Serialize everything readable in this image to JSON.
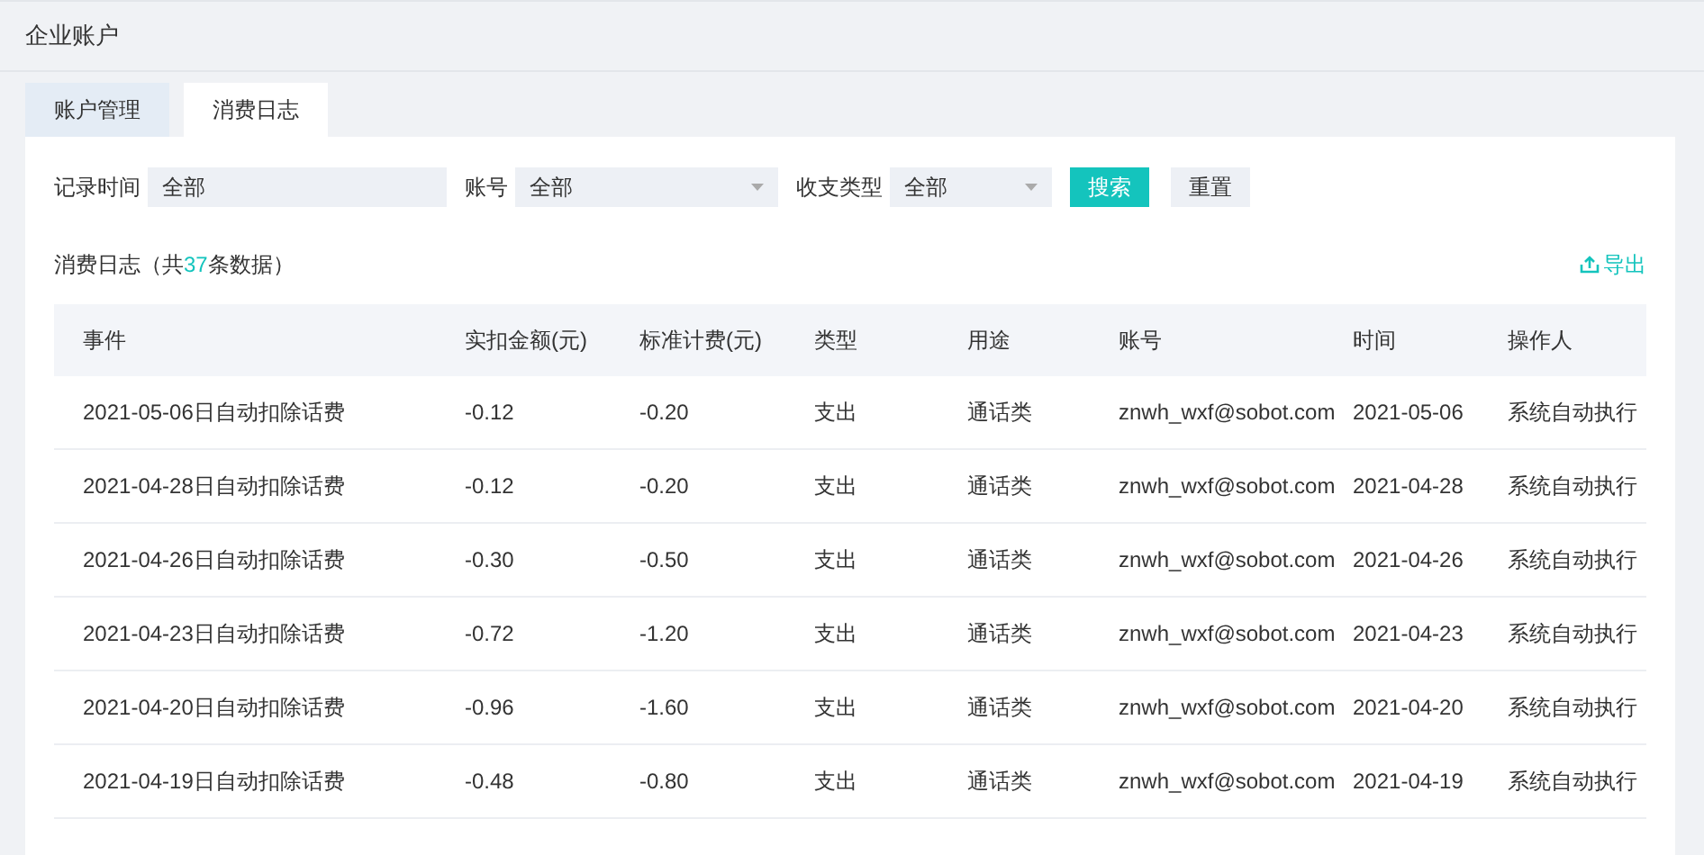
{
  "page_title": "企业账户",
  "tabs": [
    {
      "label": "账户管理",
      "selected": false
    },
    {
      "label": "消费日志",
      "selected": true
    }
  ],
  "filters": [
    {
      "label": "记录时间",
      "value": "全部",
      "kind": "text"
    },
    {
      "label": "账号",
      "value": "全部",
      "kind": "select"
    },
    {
      "label": "收支类型",
      "value": "全部",
      "kind": "select"
    }
  ],
  "buttons": [
    {
      "label": "搜索",
      "kind": "primary"
    },
    {
      "label": "重置",
      "kind": "default"
    }
  ],
  "caption": {
    "prefix": "消费日志（共",
    "count": "37",
    "suffix": "条数据）"
  },
  "export_link": "导出",
  "table": {
    "columns": [
      "事件",
      "实扣金额(元)",
      "标准计费(元)",
      "类型",
      "用途",
      "账号",
      "时间",
      "操作人"
    ],
    "rows": [
      [
        "2021-05-06日自动扣除话费",
        "-0.12",
        "-0.20",
        "支出",
        "通话类",
        "znwh_wxf@sobot.com",
        "2021-05-06",
        "系统自动执行"
      ],
      [
        "2021-04-28日自动扣除话费",
        "-0.12",
        "-0.20",
        "支出",
        "通话类",
        "znwh_wxf@sobot.com",
        "2021-04-28",
        "系统自动执行"
      ],
      [
        "2021-04-26日自动扣除话费",
        "-0.30",
        "-0.50",
        "支出",
        "通话类",
        "znwh_wxf@sobot.com",
        "2021-04-26",
        "系统自动执行"
      ],
      [
        "2021-04-23日自动扣除话费",
        "-0.72",
        "-1.20",
        "支出",
        "通话类",
        "znwh_wxf@sobot.com",
        "2021-04-23",
        "系统自动执行"
      ],
      [
        "2021-04-20日自动扣除话费",
        "-0.96",
        "-1.60",
        "支出",
        "通话类",
        "znwh_wxf@sobot.com",
        "2021-04-20",
        "系统自动执行"
      ],
      [
        "2021-04-19日自动扣除话费",
        "-0.48",
        "-0.80",
        "支出",
        "通话类",
        "znwh_wxf@sobot.com",
        "2021-04-19",
        "系统自动执行"
      ]
    ]
  }
}
